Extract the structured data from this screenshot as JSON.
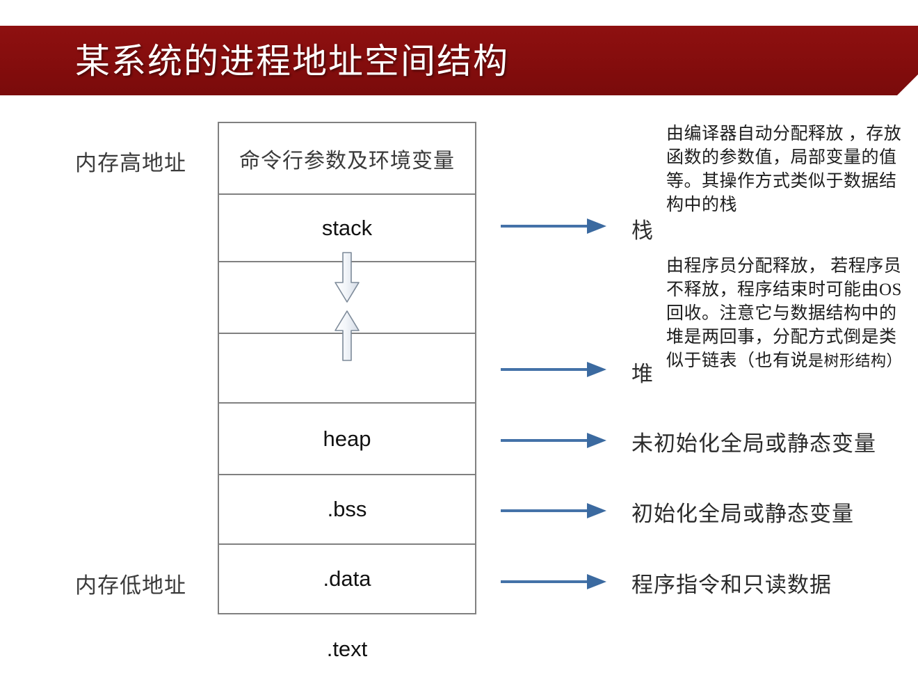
{
  "slide": {
    "title": "某系统的进程地址空间结构",
    "banner_color": "#8a0f0f",
    "banner_text_color": "#ffffff",
    "accent_arrow_color": "#4472a8",
    "box_border_color": "#808080"
  },
  "address_labels": {
    "high": "内存高地址",
    "low": "内存低地址"
  },
  "memory_map": {
    "rows": [
      {
        "label": "命令行参数及环境变量",
        "style": "cn"
      },
      {
        "label": "stack",
        "style": "en"
      },
      {
        "label": "",
        "style": "arrow-down"
      },
      {
        "label": "",
        "style": "arrow-up"
      },
      {
        "label": "heap",
        "style": "en"
      },
      {
        "label": ".bss",
        "style": "en"
      },
      {
        "label": ".data",
        "style": "en"
      },
      {
        "label": ".text",
        "style": "en"
      }
    ]
  },
  "callouts": {
    "stack": {
      "key": "栈",
      "note": "由编译器自动分配释放 ，存放函数的参数值，局部变量的值等。其操作方式类似于数据结构中的栈"
    },
    "heap": {
      "key": "堆",
      "note_main": "由程序员分配释放， 若程序员不释放，程序结束时可能由OS回收。注意它与数据结构中的堆是两回事，分配方式倒是类似于链表（也有说",
      "note_tail": "是树形结构）"
    },
    "bss": {
      "desc": "未初始化全局或静态变量"
    },
    "data": {
      "desc": "初始化全局或静态变量"
    },
    "text": {
      "desc": "程序指令和只读数据"
    }
  },
  "icons": {
    "arrow_down": "block-arrow-down-icon",
    "arrow_up": "block-arrow-up-icon",
    "connector": "right-arrow-icon"
  }
}
